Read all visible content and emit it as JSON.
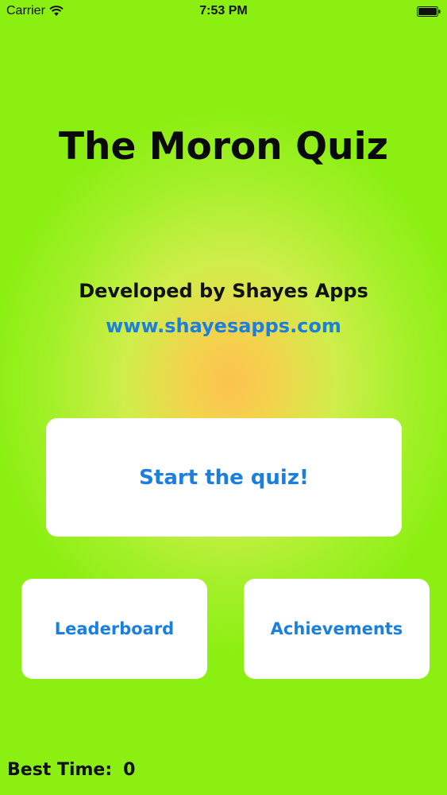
{
  "status_bar": {
    "carrier": "Carrier",
    "time": "7:53 PM",
    "icons": [
      "wifi-icon",
      "battery-icon"
    ]
  },
  "app": {
    "title": "The Moron Quiz",
    "developer": "Developed by Shayes Apps",
    "website": "www.shayesapps.com"
  },
  "buttons": {
    "start": "Start the quiz!",
    "leaderboard": "Leaderboard",
    "achievements": "Achievements"
  },
  "best_time": {
    "label": "Best Time:",
    "value": "0"
  },
  "colors": {
    "background_outer": "#8cef12",
    "background_center": "#fcc24f",
    "link_blue": "#1a7fe0",
    "button_bg": "#ffffff",
    "text_dark": "#0a0a0a"
  }
}
